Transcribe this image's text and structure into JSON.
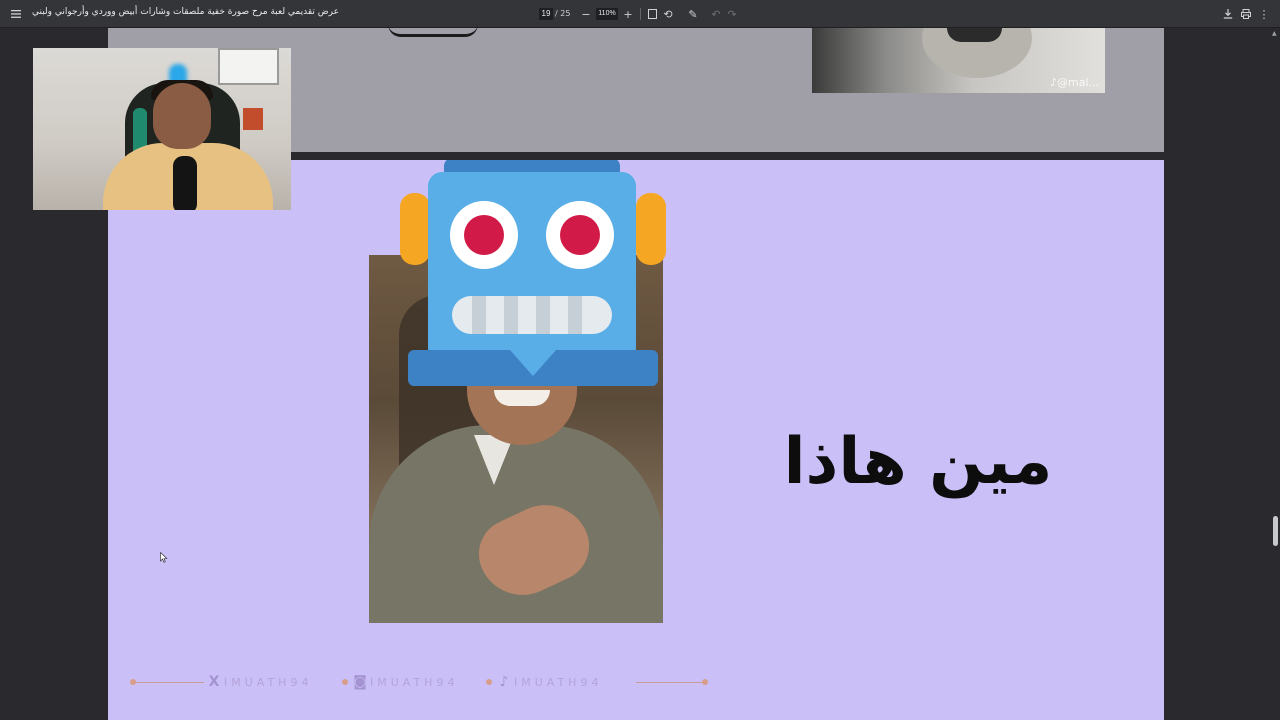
{
  "toolbar": {
    "title": "عرض تقديمي لعبة مرح صورة خفية ملصقات وشارات أبيض ووردي وأرجواني ولبني",
    "page_current": "19",
    "page_total": "/ 25",
    "zoom": "110%",
    "icons": [
      "menu-icon",
      "zoom-out-icon",
      "zoom-in-icon",
      "fit-page-icon",
      "rotate-icon",
      "draw-icon",
      "undo-icon",
      "redo-icon",
      "download-icon",
      "print-icon",
      "more-icon"
    ]
  },
  "slide_prev": {
    "tiktok_handle": "@mal..."
  },
  "slide_current": {
    "question": "مين هاذا",
    "robot_emoji": "robot-icon",
    "watermark_handle_1": "IMUATH94",
    "watermark_handle_2": "IMUATH94",
    "watermark_handle_3": "IMUATH94",
    "colors": {
      "background": "#cbbff8",
      "watermark": "#b4a3d8"
    }
  }
}
